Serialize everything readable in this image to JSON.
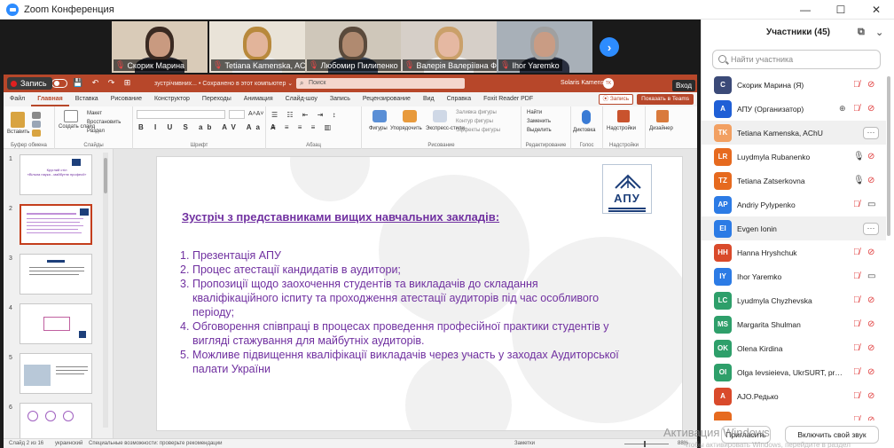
{
  "window": {
    "title": "Zoom Конференция",
    "controls": [
      "—",
      "☐",
      "✕"
    ]
  },
  "thumbnails": [
    {
      "name": "Скорик Марина",
      "bg": "#d9cbb8",
      "face": "#c99a80",
      "hair": "#3a2a22",
      "clothes": "#2b2b33"
    },
    {
      "name": "Tetiana Kamenska, ACHU",
      "bg": "#e9e3d8",
      "face": "#e2b49a",
      "hair": "#b8893c",
      "clothes": "#f0f0f0"
    },
    {
      "name": "Любомир Пилипенко",
      "bg": "#cfc7ba",
      "face": "#b08a70",
      "hair": "#5a4a3c",
      "clothes": "#3a4658"
    },
    {
      "name": "Валерія Валеріївна Фе...",
      "bg": "#d6cfc8",
      "face": "#e5b8a2",
      "hair": "#caa06a",
      "clothes": "#f2f2f2"
    },
    {
      "name": "Ihor Yaremko",
      "bg": "#a8b0b8",
      "face": "#c99c84",
      "hair": "#a0a0a0",
      "clothes": "#2a3040"
    }
  ],
  "ppt": {
    "recording_label": "Запись",
    "quick_access": "💾 ↶ ↷ ⊞",
    "doc_name": "зустрічмвних... • Сохранено в этот компьютер ⌄",
    "search_placeholder": "Поиск",
    "user_name": "Solaris Kamenska",
    "user_initials": "TK",
    "signin_tooltip": "Вход",
    "tabs": [
      "Файл",
      "Главная",
      "Вставка",
      "Рисование",
      "Конструктор",
      "Переходы",
      "Анимация",
      "Слайд-шоу",
      "Запись",
      "Рецензирование",
      "Вид",
      "Справка",
      "Foxit Reader PDF"
    ],
    "active_tab": "Главная",
    "ribbon_buttons": {
      "record": "⦿ Запись",
      "share_teams": "Показать в Teams"
    },
    "groups": {
      "clipboard": "Буфер обмена",
      "clipboard_paste": "Вставить",
      "slides": "Слайды",
      "create_slide": "Создать слайд",
      "layout": "Макет",
      "reset": "Восстановить",
      "section": "Раздел",
      "font": "Шрифт",
      "paragraph": "Абзац",
      "drawing": "Рисование",
      "shapes": "Фигуры",
      "arrange": "Упорядочить",
      "quick_styles": "Экспресс-стили",
      "shape_fill": "Заливка фигуры",
      "shape_outline": "Контур фигуры",
      "shape_effects": "Эффекты фигуры",
      "editing": "Редактирование",
      "find": "Найти",
      "replace": "Заменить",
      "select": "Выделить",
      "voice": "Голос",
      "dictate": "Диктовка",
      "addins": "Надстройки",
      "addins_btn": "Надстройки",
      "designer": "Дизайнер"
    },
    "slide_numbers": [
      "1",
      "2",
      "3",
      "4",
      "5",
      "6"
    ],
    "thumb1_title": "Круглий стіл\n«Вільна наука - майбутнє професії»",
    "status": {
      "slide_count": "Слайд 2 из 16",
      "language": "украинский",
      "accessibility": "Специальные возможности: проверьте рекомендации",
      "notes": "Заметки",
      "zoom": "88%"
    }
  },
  "slide": {
    "logo_text": "АПУ",
    "heading": "Зустріч з представниками вищих навчальних закладів:",
    "items": [
      {
        "num": "1.",
        "text": "Презентація АПУ"
      },
      {
        "num": "2.",
        "text": "Процес атестації кандидатів в аудитори;"
      },
      {
        "num": "3.",
        "text": "Пропозиції щодо заохочення студентів та викладачів до складання кваліфікаційного іспиту та проходження атестації аудиторів під час особливого періоду;"
      },
      {
        "num": "4.",
        "text": "Обговорення співпраці в процесах проведення професійної практики студентів у вигляді стажування для майбутніх аудиторів."
      },
      {
        "num": "5.",
        "text": "Можливе підвищення кваліфікації викладачів через участь у заходах Аудиторської палати України"
      }
    ],
    "text_color": "#7030a0"
  },
  "watermark": {
    "line1": "Активация Windows",
    "line2": "Чтобы активировать Windows, перейдите в раздел"
  },
  "participants": {
    "title": "Участники (45)",
    "search_placeholder": "Найти участника",
    "list": [
      {
        "initials": "C",
        "name": "Скорик Марина (Я)",
        "color": "#3b4a78",
        "mic": "muted",
        "cam": "off"
      },
      {
        "initials": "A",
        "name": "АПУ (Организатор)",
        "color": "#1f5fd6",
        "mic": "muted",
        "cam": "off",
        "extra": "⊕"
      },
      {
        "initials": "TK",
        "name": "Tetiana Kamenska, AChU",
        "color": "#f2a062",
        "more": true,
        "highlight": true
      },
      {
        "initials": "LR",
        "name": "Luydmyla Rubanenko",
        "color": "#e66a1f",
        "mic": "on",
        "cam": "off"
      },
      {
        "initials": "TZ",
        "name": "Tetiana Zatserkovna",
        "color": "#e66a1f",
        "mic": "on",
        "cam": "off"
      },
      {
        "initials": "AP",
        "name": "Andriy Pylypenko",
        "color": "#2c7be5",
        "mic": "muted",
        "cam": "on"
      },
      {
        "initials": "EI",
        "name": "Evgen Ionin",
        "color": "#2c7be5",
        "more": true,
        "highlight": true
      },
      {
        "initials": "HH",
        "name": "Hanna Hryshchuk",
        "color": "#d94a2b",
        "mic": "muted",
        "cam": "off"
      },
      {
        "initials": "IY",
        "name": "Ihor Yaremko",
        "color": "#2c7be5",
        "mic": "muted",
        "cam": "on"
      },
      {
        "initials": "LC",
        "name": "Lyudmyla Chyzhevska",
        "color": "#2e9f6a",
        "mic": "muted",
        "cam": "off"
      },
      {
        "initials": "MS",
        "name": "Margarita Shulman",
        "color": "#2e9f6a",
        "mic": "muted",
        "cam": "off"
      },
      {
        "initials": "OK",
        "name": "Olena Kirdina",
        "color": "#2e9f6a",
        "mic": "muted",
        "cam": "off"
      },
      {
        "initials": "OI",
        "name": "Olga Ievsieieva, UkrSURT, profes...",
        "color": "#2e9f6a",
        "mic": "muted",
        "cam": "off"
      },
      {
        "initials": "A",
        "name": "AJO.Редько",
        "color": "#d94a2b",
        "mic": "muted",
        "cam": "off"
      },
      {
        "initials": "",
        "name": "",
        "color": "#e66a1f",
        "mic": "muted",
        "cam": "off"
      }
    ],
    "invite_button": "Пригласить",
    "unmute_button": "Включить свой звук"
  }
}
